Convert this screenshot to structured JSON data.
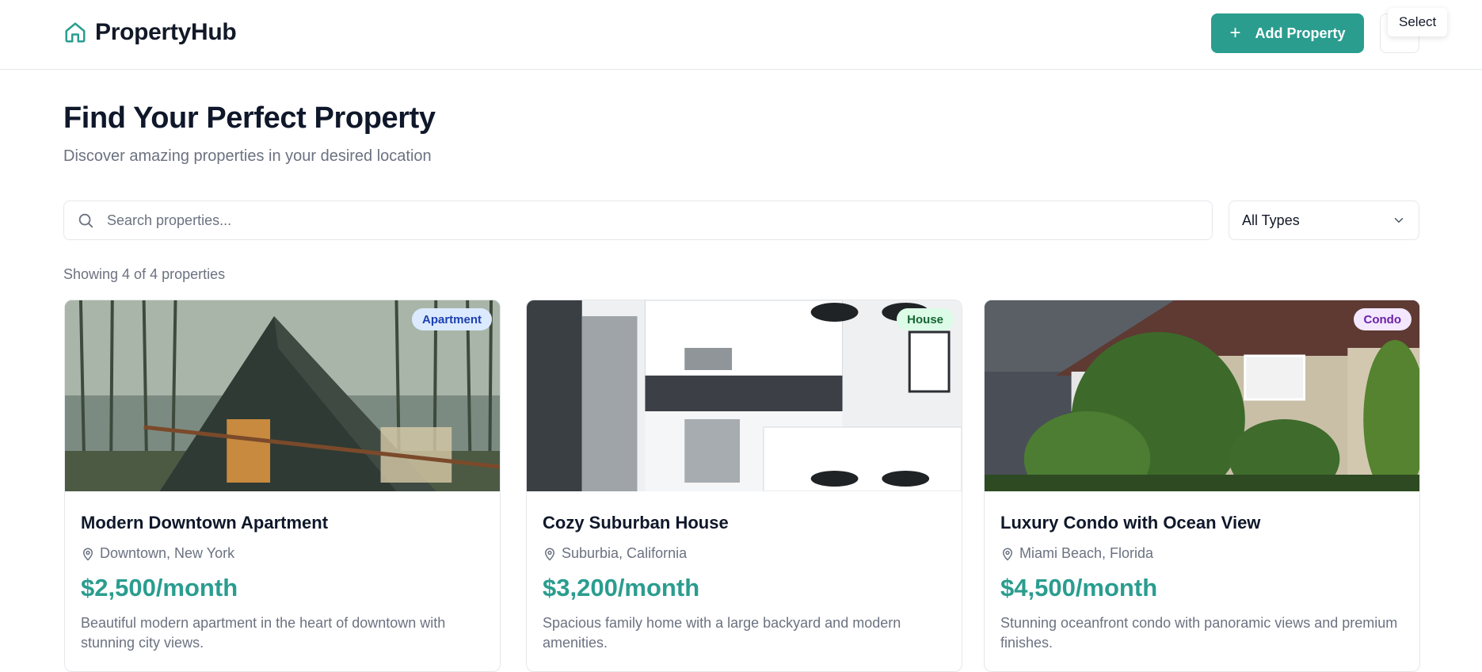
{
  "header": {
    "brand": "PropertyHub",
    "add_button": "Add Property",
    "tooltip": "Select"
  },
  "hero": {
    "title": "Find Your Perfect Property",
    "subtitle": "Discover amazing properties in your desired location"
  },
  "search": {
    "placeholder": "Search properties...",
    "value": ""
  },
  "filter": {
    "selected": "All Types"
  },
  "results": {
    "count_text": "Showing 4 of 4 properties"
  },
  "colors": {
    "accent": "#2a9d8f",
    "apartment_badge_bg": "#dbeafe",
    "apartment_badge_fg": "#1e40af",
    "house_badge_bg": "#dcfce7",
    "house_badge_fg": "#166534",
    "condo_badge_bg": "#f3e8ff",
    "condo_badge_fg": "#6b21a8"
  },
  "properties": [
    {
      "type": "Apartment",
      "title": "Modern Downtown Apartment",
      "location": "Downtown, New York",
      "price": "$2,500/month",
      "description": "Beautiful modern apartment in the heart of downtown with stunning city views."
    },
    {
      "type": "House",
      "title": "Cozy Suburban House",
      "location": "Suburbia, California",
      "price": "$3,200/month",
      "description": "Spacious family home with a large backyard and modern amenities."
    },
    {
      "type": "Condo",
      "title": "Luxury Condo with Ocean View",
      "location": "Miami Beach, Florida",
      "price": "$4,500/month",
      "description": "Stunning oceanfront condo with panoramic views and premium finishes."
    }
  ]
}
